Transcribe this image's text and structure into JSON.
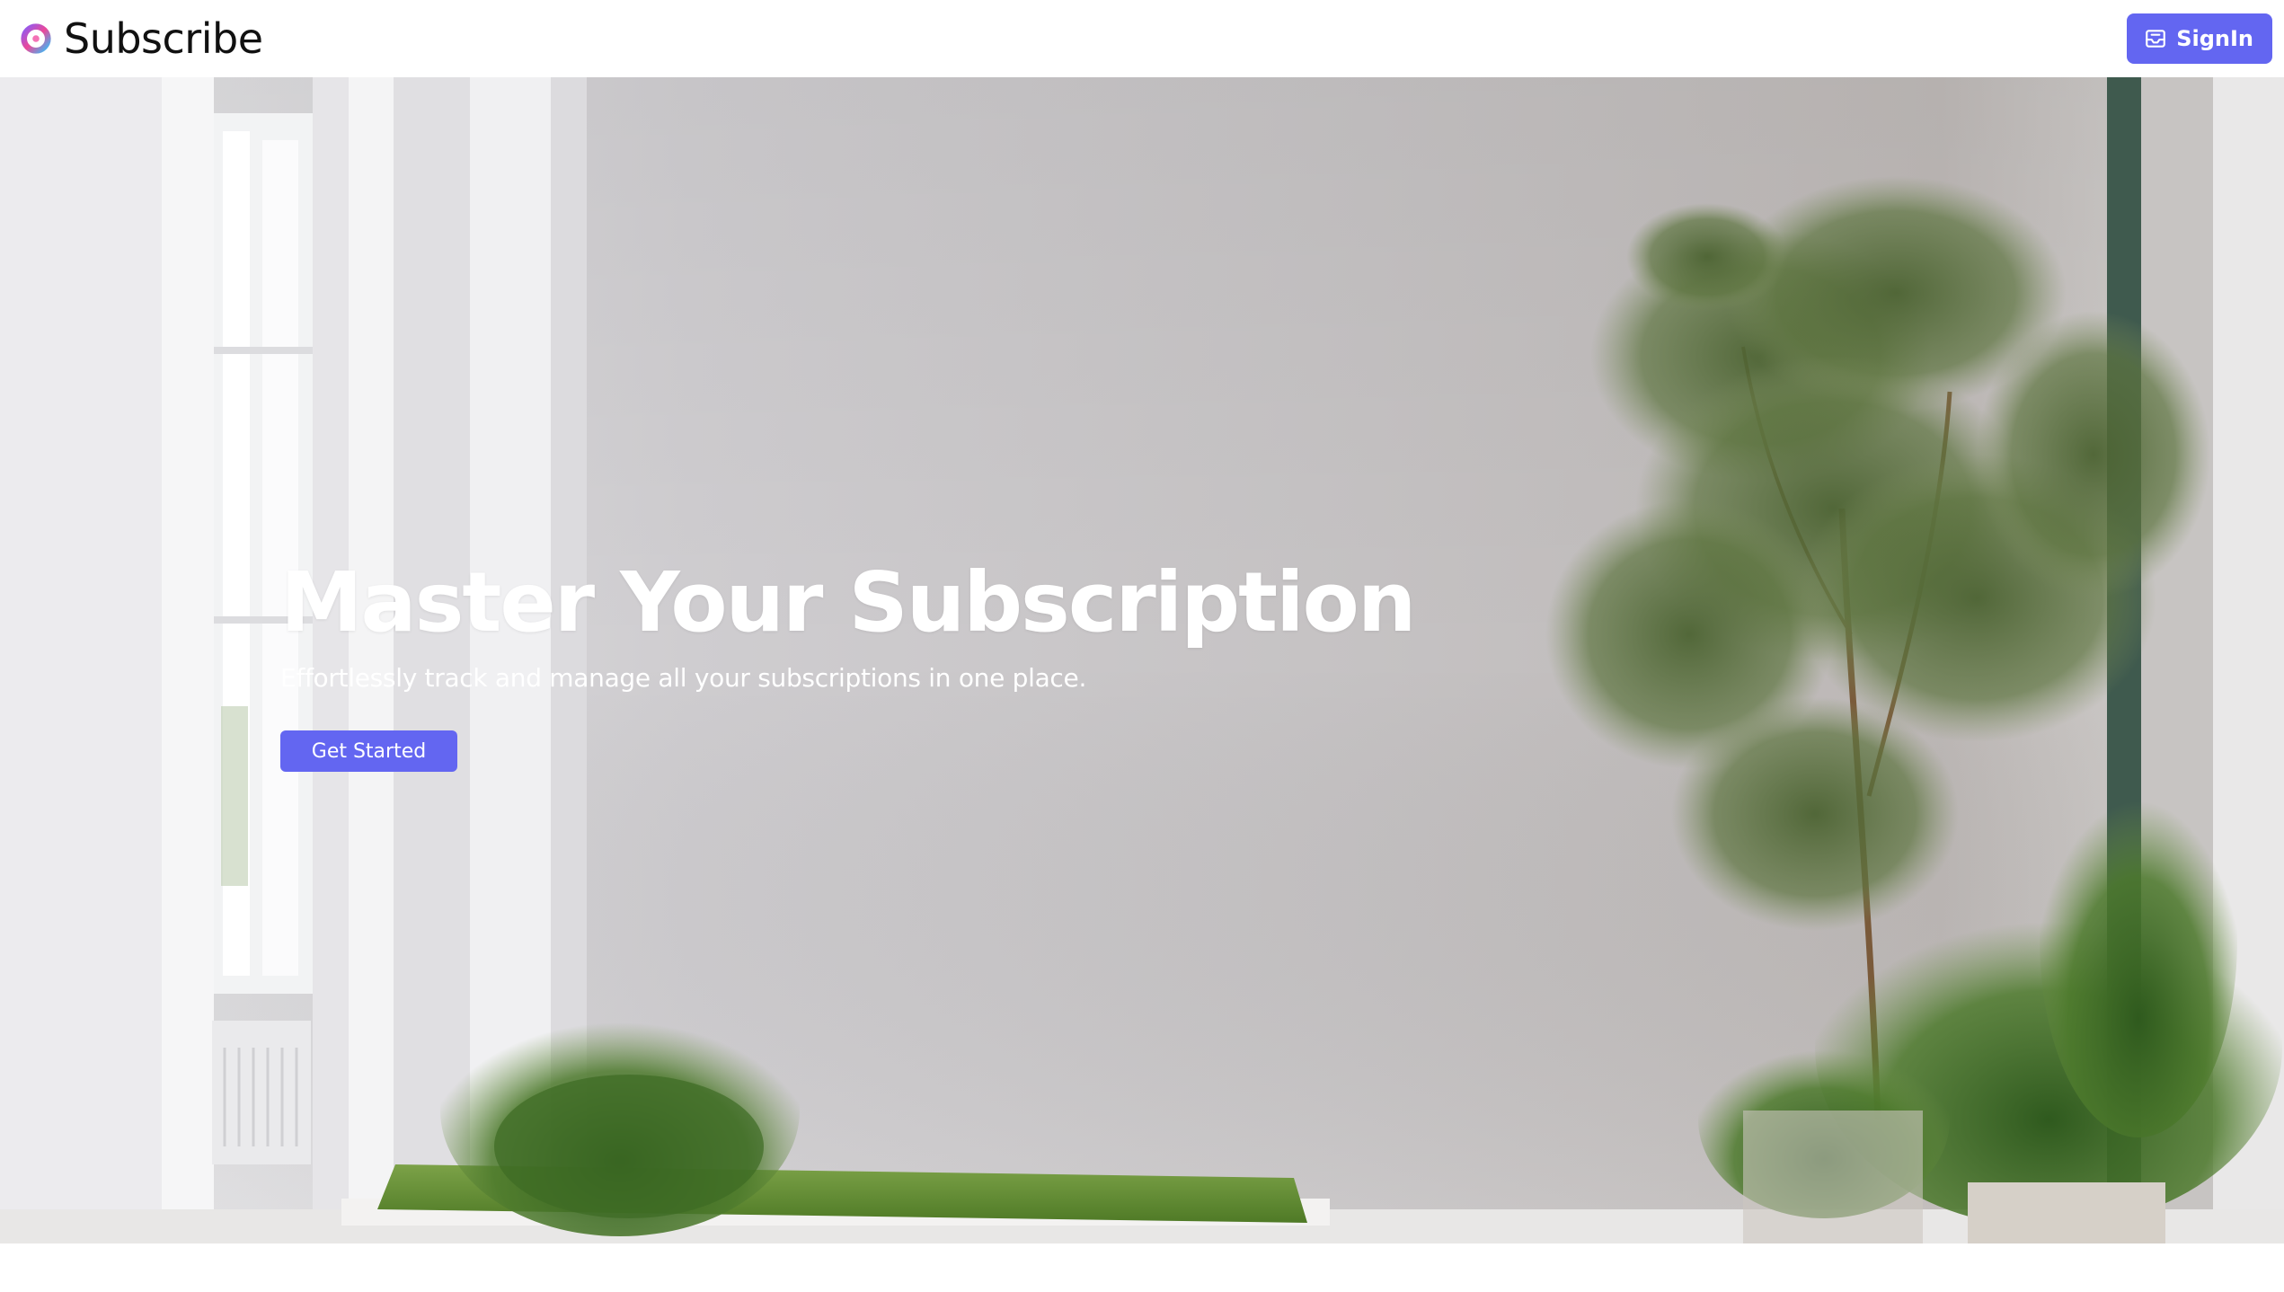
{
  "header": {
    "brand_name": "Subscribe",
    "logo_icon": "ring-logo-icon",
    "signin_label": "SignIn",
    "signin_icon": "inbox-icon"
  },
  "hero": {
    "title": "Master Your Subscription",
    "subtitle": "Effortlessly track and manage all your subscriptions in one place.",
    "cta_label": "Get Started",
    "background": "room-with-plants-image"
  },
  "colors": {
    "accent": "#6366f1",
    "hero_text": "#ffffff",
    "nav_background": "#ffffff"
  }
}
